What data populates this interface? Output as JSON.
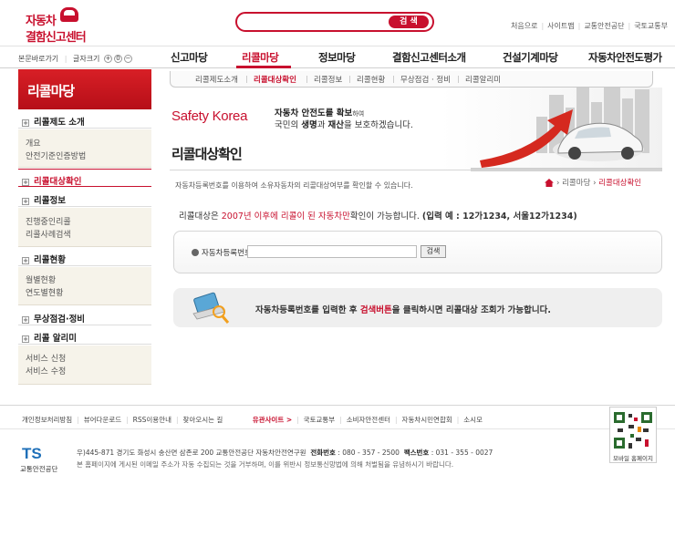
{
  "header": {
    "logo_line1": "자동차",
    "logo_line2": "결함신고센터",
    "search_button": "검 색",
    "search_value": "",
    "util_links": [
      "처음으로",
      "사이트맵",
      "교통안전공단",
      "국토교통부"
    ]
  },
  "gnb": {
    "shortcut": "본문바로가기",
    "font_size": "글자크기",
    "zoom_in": "+",
    "zoom_reset": "0",
    "zoom_out": "−",
    "items": [
      "신고마당",
      "리콜마당",
      "정보마당",
      "결함신고센터소개",
      "건설기계마당",
      "자동차안전도평가"
    ],
    "active_index": 1
  },
  "subnav": {
    "items": [
      "리콜제도소개",
      "리콜대상확인",
      "리콜정보",
      "리콜현황",
      "무상점검 · 정비",
      "리콜알리미"
    ],
    "active_index": 1
  },
  "lnb": {
    "title": "리콜마당",
    "sections": [
      {
        "label": "리콜제도 소개",
        "subs": [
          "개요",
          "안전기준인증방법"
        ]
      },
      {
        "label": "리콜대상확인",
        "subs": []
      },
      {
        "label": "리콜정보",
        "subs": [
          "진행중인리콜",
          "리콜사례검색"
        ]
      },
      {
        "label": "리콜현황",
        "subs": [
          "월별현황",
          "연도별현황"
        ]
      },
      {
        "label": "무상점검·정비",
        "subs": []
      },
      {
        "label": "리콜 알리미",
        "subs": [
          "서비스 신청",
          "서비스 수정"
        ]
      }
    ]
  },
  "banner": {
    "brand": "Safety Korea",
    "slogan1_pre": "자동차 안전도를 확보",
    "slogan1_post": "하여",
    "slogan2_a": "국민의 ",
    "slogan2_b": "생명",
    "slogan2_c": "과 ",
    "slogan2_d": "재산",
    "slogan2_e": "을 보호하겠습니다."
  },
  "content": {
    "title": "리콜대상확인",
    "description": "자동차등록번호를 이용하여 소유자동차의 리콜대상여부를 확인할 수 있습니다.",
    "breadcrumb": [
      "리콜마당",
      "리콜대상확인"
    ],
    "notice_a": "리콜대상은 ",
    "notice_b": "2007년 이후에 리콜이 된 자동차만",
    "notice_c": "확인이 가능합니다. ",
    "notice_d": "(입력 예 : 12가1234, 서울12가1234)",
    "form_label": "자동차등록번호",
    "form_value": "",
    "form_button": "검색",
    "guide_a": "자동차등록번호를 입력한 후 ",
    "guide_b": "검색버튼",
    "guide_c": "을 클릭하시면 리콜대상 조회가 가능합니다."
  },
  "footer": {
    "links": [
      "개인정보처리방침",
      "뷰어다운로드",
      "RSS이용안내",
      "찾아오시는 길"
    ],
    "family_label": "유관사이트  >",
    "family_links": [
      "국토교통부",
      "소비자안전센터",
      "자동차시민연합회",
      "소시모"
    ],
    "logo": "TS",
    "logo_name": "교통안전공단",
    "address": "우)445-871 경기도 화성시 송산면 삼존로 200 교통안전공단 자동차안전연구원",
    "tel_label": "전화번호",
    "tel": " : 080 - 357 - 2500",
    "fax_label": "팩스번호",
    "fax": " : 031 - 355 - 0027",
    "copyright": "본 홈페이지에 게시된 이메일 주소가 자동 수집되는 것을 거부하며, 이를 위반시 정보통신망법에 의해 처벌됨을 유념하시기 바랍니다.",
    "qr_caption": "모바일 홈페이지"
  }
}
